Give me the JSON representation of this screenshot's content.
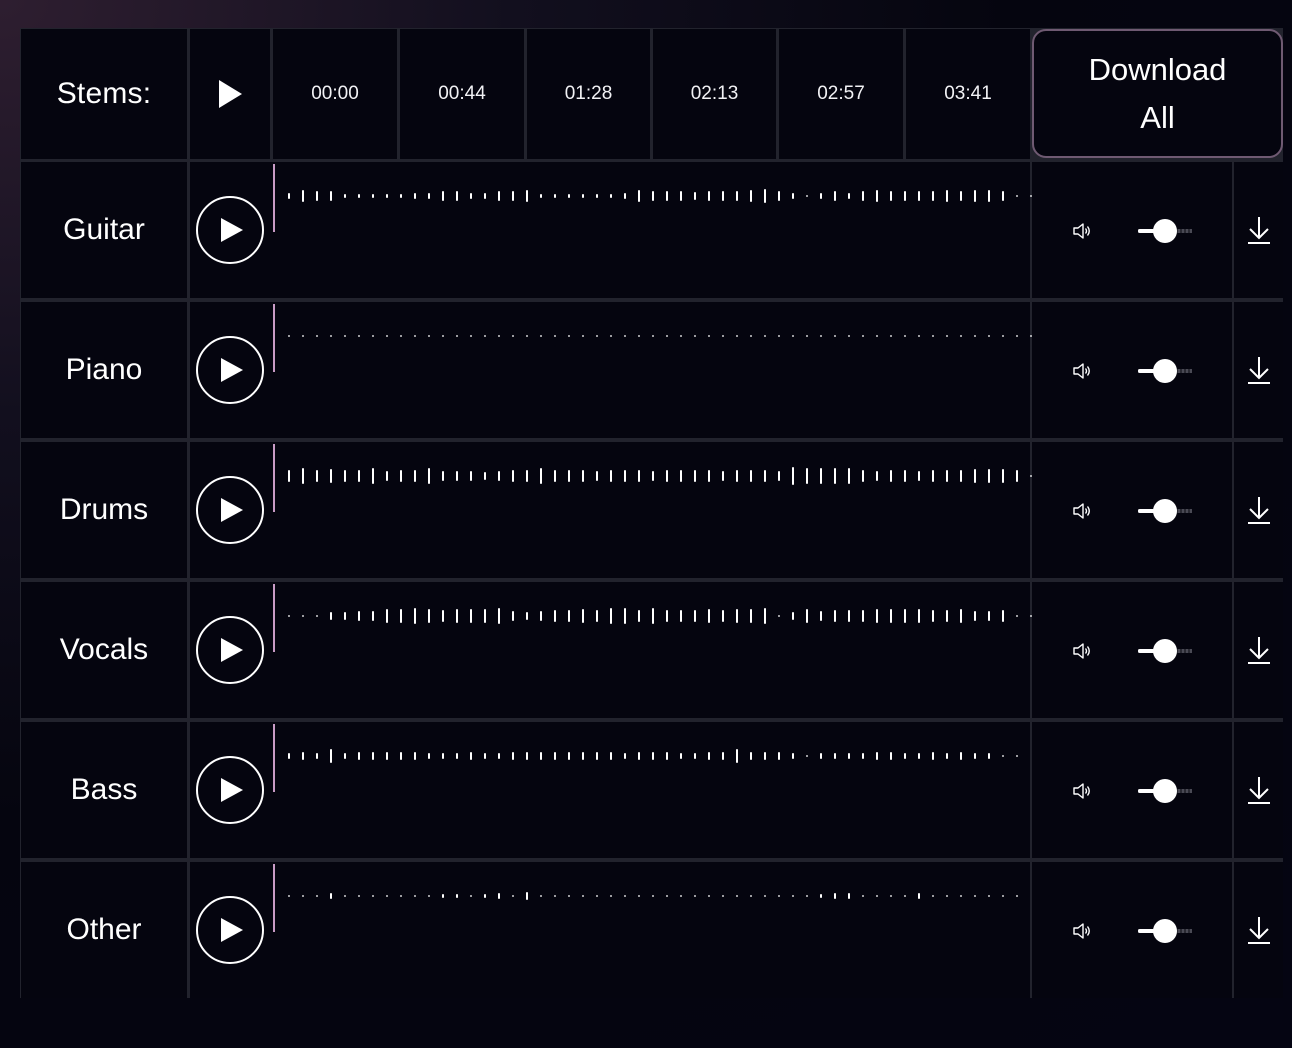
{
  "header": {
    "stems_label": "Stems:",
    "play_all_icon": "play-icon",
    "timestamps": [
      "00:00",
      "00:44",
      "01:28",
      "02:13",
      "02:57",
      "03:41"
    ],
    "download_all_line1": "Download",
    "download_all_line2": "All"
  },
  "colors": {
    "background": "#05050f",
    "grid_line": "#22232d",
    "playhead": "#c89bc5",
    "download_all_border": "#6f5a72",
    "foreground": "#ffffff"
  },
  "stems": [
    {
      "name": "Guitar",
      "volume": 0.5,
      "waveform": [
        0.3,
        0.6,
        0.5,
        0.5,
        0.2,
        0.2,
        0.2,
        0.2,
        0.2,
        0.3,
        0.3,
        0.5,
        0.5,
        0.3,
        0.3,
        0.5,
        0.5,
        0.6,
        0.2,
        0.2,
        0.2,
        0.2,
        0.2,
        0.2,
        0.3,
        0.6,
        0.5,
        0.5,
        0.5,
        0.4,
        0.5,
        0.5,
        0.5,
        0.6,
        0.7,
        0.5,
        0.3,
        0.05,
        0.3,
        0.5,
        0.3,
        0.5,
        0.6,
        0.5,
        0.5,
        0.5,
        0.5,
        0.6,
        0.5,
        0.6,
        0.6,
        0.5,
        0.05,
        0.05
      ]
    },
    {
      "name": "Piano",
      "volume": 0.5,
      "waveform": [
        0.05,
        0.05,
        0.05,
        0.05,
        0.05,
        0.05,
        0.05,
        0.05,
        0.05,
        0.05,
        0.05,
        0.05,
        0.05,
        0.05,
        0.05,
        0.05,
        0.05,
        0.05,
        0.05,
        0.05,
        0.05,
        0.05,
        0.05,
        0.05,
        0.05,
        0.05,
        0.05,
        0.05,
        0.05,
        0.05,
        0.05,
        0.05,
        0.05,
        0.05,
        0.05,
        0.05,
        0.05,
        0.05,
        0.05,
        0.05,
        0.05,
        0.05,
        0.05,
        0.05,
        0.05,
        0.05,
        0.05,
        0.05,
        0.05,
        0.05,
        0.05,
        0.05,
        0.05,
        0.05
      ]
    },
    {
      "name": "Drums",
      "volume": 0.5,
      "waveform": [
        0.6,
        0.8,
        0.6,
        0.7,
        0.6,
        0.6,
        0.8,
        0.5,
        0.6,
        0.6,
        0.8,
        0.5,
        0.5,
        0.5,
        0.4,
        0.5,
        0.6,
        0.6,
        0.8,
        0.6,
        0.6,
        0.6,
        0.5,
        0.6,
        0.6,
        0.6,
        0.5,
        0.6,
        0.6,
        0.6,
        0.6,
        0.5,
        0.6,
        0.6,
        0.6,
        0.5,
        0.9,
        0.8,
        0.8,
        0.8,
        0.8,
        0.6,
        0.5,
        0.6,
        0.6,
        0.5,
        0.6,
        0.6,
        0.6,
        0.7,
        0.7,
        0.7,
        0.6,
        0.05,
        0.05
      ]
    },
    {
      "name": "Vocals",
      "volume": 0.5,
      "waveform": [
        0.05,
        0.05,
        0.1,
        0.4,
        0.4,
        0.5,
        0.5,
        0.7,
        0.7,
        0.8,
        0.7,
        0.6,
        0.7,
        0.7,
        0.7,
        0.8,
        0.5,
        0.4,
        0.5,
        0.6,
        0.6,
        0.7,
        0.6,
        0.8,
        0.8,
        0.6,
        0.8,
        0.6,
        0.6,
        0.6,
        0.7,
        0.6,
        0.7,
        0.7,
        0.8,
        0.1,
        0.4,
        0.7,
        0.5,
        0.6,
        0.6,
        0.6,
        0.7,
        0.7,
        0.7,
        0.7,
        0.6,
        0.6,
        0.7,
        0.5,
        0.5,
        0.6,
        0.1,
        0.05,
        0.05
      ]
    },
    {
      "name": "Bass",
      "volume": 0.5,
      "waveform": [
        0.3,
        0.4,
        0.3,
        0.7,
        0.3,
        0.4,
        0.4,
        0.4,
        0.4,
        0.4,
        0.3,
        0.3,
        0.3,
        0.4,
        0.3,
        0.3,
        0.4,
        0.4,
        0.4,
        0.4,
        0.4,
        0.4,
        0.4,
        0.4,
        0.3,
        0.4,
        0.4,
        0.4,
        0.3,
        0.3,
        0.4,
        0.4,
        0.7,
        0.4,
        0.4,
        0.4,
        0.3,
        0.05,
        0.3,
        0.3,
        0.3,
        0.3,
        0.4,
        0.4,
        0.3,
        0.3,
        0.4,
        0.3,
        0.4,
        0.3,
        0.3,
        0.05,
        0.05
      ]
    },
    {
      "name": "Other",
      "volume": 0.5,
      "waveform": [
        0.1,
        0.1,
        0.1,
        0.3,
        0.1,
        0.05,
        0.1,
        0.05,
        0.05,
        0.1,
        0.05,
        0.2,
        0.2,
        0.1,
        0.2,
        0.3,
        0.1,
        0.4,
        0.05,
        0.05,
        0.05,
        0.05,
        0.05,
        0.05,
        0.1,
        0.1,
        0.1,
        0.1,
        0.1,
        0.1,
        0.1,
        0.05,
        0.05,
        0.1,
        0.1,
        0.05,
        0.05,
        0.05,
        0.2,
        0.3,
        0.3,
        0.1,
        0.05,
        0.1,
        0.1,
        0.3,
        0.1,
        0.1,
        0.1,
        0.05,
        0.05,
        0.05,
        0.05
      ]
    }
  ]
}
